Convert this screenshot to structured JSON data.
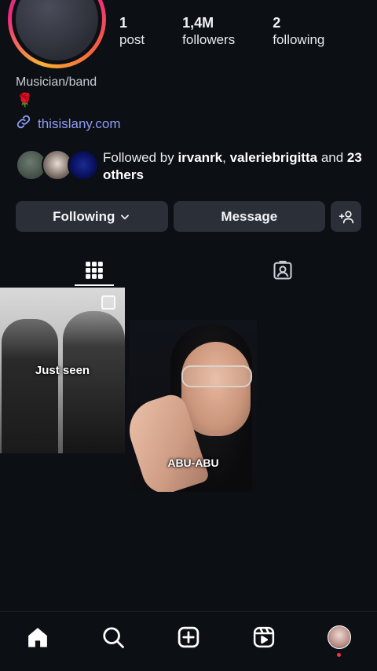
{
  "profile": {
    "stats": [
      {
        "value": "1",
        "label": "post"
      },
      {
        "value": "1,4M",
        "label": "followers"
      },
      {
        "value": "2",
        "label": "following"
      }
    ],
    "category": "Musician/band",
    "bio_emoji": "🌹",
    "link_text": "thisislany.com",
    "followed_by": {
      "prefix": "Followed by ",
      "user1": "irvanrk",
      "sep": ", ",
      "user2": "valeriebrigitta",
      "mid": " and ",
      "others": "23 others"
    }
  },
  "actions": {
    "following_label": "Following",
    "message_label": "Message"
  },
  "tabs": [
    {
      "name": "posts-grid",
      "icon": "grid-icon",
      "active": true
    },
    {
      "name": "tagged",
      "icon": "tagged-person-icon",
      "active": false
    }
  ],
  "posts": [
    {
      "caption": "Just seen"
    },
    {
      "caption": "ABU-ABU"
    }
  ],
  "nav": [
    {
      "icon": "home-icon"
    },
    {
      "icon": "search-icon"
    },
    {
      "icon": "create-icon"
    },
    {
      "icon": "reels-icon"
    },
    {
      "icon": "profile-avatar"
    }
  ],
  "colors": {
    "background": "#0c0f14",
    "link": "#8f9cf2",
    "button": "#2b2f38",
    "notification_dot": "#ff3040"
  }
}
